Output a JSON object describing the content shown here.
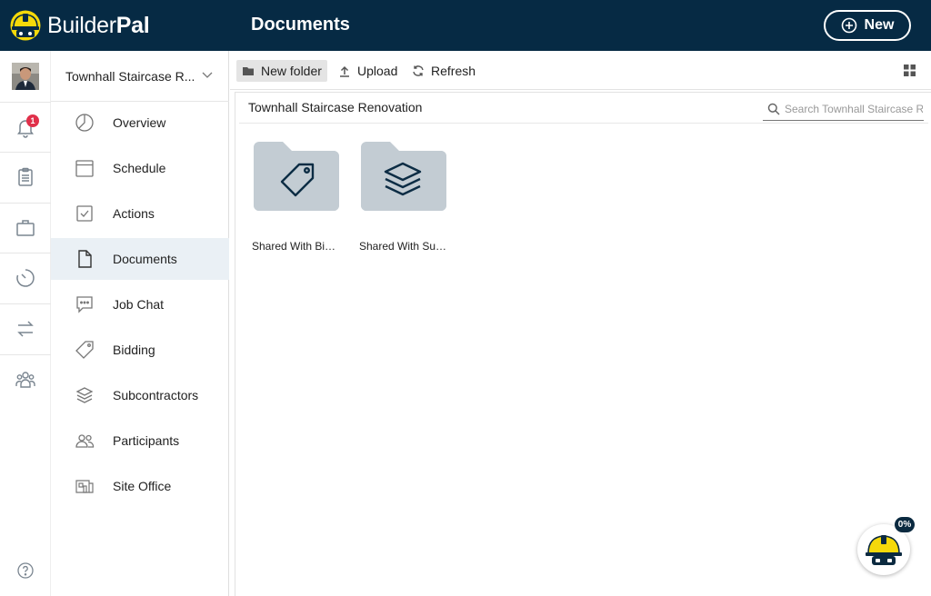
{
  "app": {
    "brand_regular": "Builder",
    "brand_bold": "Pal",
    "page_title": "Documents",
    "new_button": "New"
  },
  "rail": {
    "notifications_count": "1"
  },
  "sidebar": {
    "project_name": "Townhall Staircase R...",
    "items": [
      {
        "label": "Overview",
        "icon": "pie-chart-icon"
      },
      {
        "label": "Schedule",
        "icon": "calendar-icon"
      },
      {
        "label": "Actions",
        "icon": "checkbox-icon"
      },
      {
        "label": "Documents",
        "icon": "document-icon",
        "active": true
      },
      {
        "label": "Job Chat",
        "icon": "chat-icon"
      },
      {
        "label": "Bidding",
        "icon": "tag-icon"
      },
      {
        "label": "Subcontractors",
        "icon": "layers-icon"
      },
      {
        "label": "Participants",
        "icon": "people-icon"
      },
      {
        "label": "Site Office",
        "icon": "site-office-icon"
      }
    ]
  },
  "toolbar": {
    "new_folder": "New folder",
    "upload": "Upload",
    "refresh": "Refresh"
  },
  "content": {
    "breadcrumb": "Townhall Staircase Renovation",
    "search_placeholder": "Search Townhall Staircase Renovation",
    "folders": [
      {
        "label": "Shared With Bid ...",
        "icon": "tag-icon"
      },
      {
        "label": "Shared With Sub...",
        "icon": "layers-icon"
      }
    ]
  },
  "assistant": {
    "progress": "0%"
  },
  "colors": {
    "header_bg": "#062a44",
    "active_nav_bg": "#eaf0f5",
    "folder_fill": "#c3ccd3",
    "badge_red": "#e0304a",
    "helmet_yellow": "#f5d90a"
  }
}
